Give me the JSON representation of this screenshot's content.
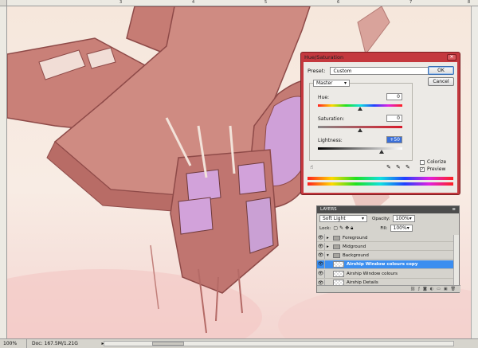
{
  "rulers": {
    "top_labels": [
      "3",
      "4",
      "5",
      "6",
      "7",
      "8"
    ]
  },
  "dialog": {
    "title": "Hue/Saturation",
    "preset_label": "Preset:",
    "preset_value": "Custom",
    "preset_menu_icon": "E.",
    "ok_label": "OK",
    "cancel_label": "Cancel",
    "channel_value": "Master",
    "hue_label": "Hue:",
    "hue_value": "0",
    "saturation_label": "Saturation:",
    "saturation_value": "0",
    "lightness_label": "Lightness:",
    "lightness_value": "+50",
    "hue_level": 0.5,
    "saturation_level": 0.5,
    "lightness_level": 0.75,
    "colorize_label": "Colorize",
    "colorize_checked": false,
    "preview_label": "Preview",
    "preview_checked": true
  },
  "layers": {
    "tab_label": "LAYERS",
    "blend_mode": "Soft Light",
    "opacity_label": "Opacity:",
    "opacity_value": "100%",
    "lock_label": "Lock:",
    "fill_label": "Fill:",
    "fill_value": "100%",
    "items": [
      {
        "name": "Foreground",
        "type": "group",
        "visible": true,
        "expanded": false
      },
      {
        "name": "Midground",
        "type": "group",
        "visible": true,
        "expanded": false
      },
      {
        "name": "Background",
        "type": "group",
        "visible": true,
        "expanded": true
      },
      {
        "name": "Airship Window colours copy",
        "type": "layer",
        "visible": true,
        "selected": true
      },
      {
        "name": "Airship Window colours",
        "type": "layer",
        "visible": true
      },
      {
        "name": "Airship Details",
        "type": "layer",
        "visible": true
      }
    ]
  },
  "statusbar": {
    "zoom": "100%",
    "doc": "Doc: 167.5M/1.21G"
  },
  "colors": {
    "dialog_frame": "#c4383e",
    "selection": "#3b8ef0",
    "canvas_sky": "#f6e7dc",
    "airship_body": "#c98078"
  }
}
